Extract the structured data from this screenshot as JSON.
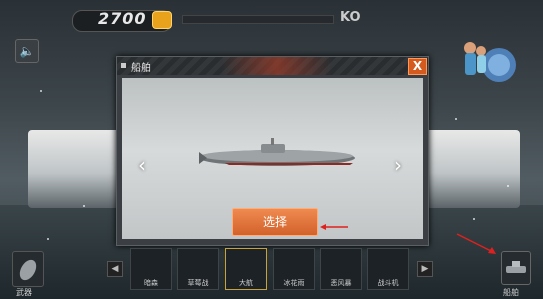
{
  "hud": {
    "coins": "2700",
    "ko_label": "KO"
  },
  "icons": {
    "sound": "speaker-icon",
    "coin": "coin-icon",
    "close": "close-icon"
  },
  "dialog": {
    "title": "船舶",
    "close_label": "X",
    "prev_arrow": "‹",
    "next_arrow": "›",
    "select_label": "选择"
  },
  "bottom_bar": {
    "weapon_label": "武器",
    "ship_label": "船舶",
    "scroll_left": "◀",
    "scroll_right": "▶",
    "slots": [
      {
        "label": "暗森",
        "selected": false
      },
      {
        "label": "草莓战",
        "selected": false
      },
      {
        "label": "大航",
        "selected": true
      },
      {
        "label": "冰花雨",
        "selected": false
      },
      {
        "label": "恶风暴",
        "selected": false
      },
      {
        "label": "战斗机",
        "selected": false
      }
    ]
  },
  "colors": {
    "accent_orange": "#d45a1e",
    "select_button": "#e07a3e",
    "pointer_red": "#e0201f"
  }
}
